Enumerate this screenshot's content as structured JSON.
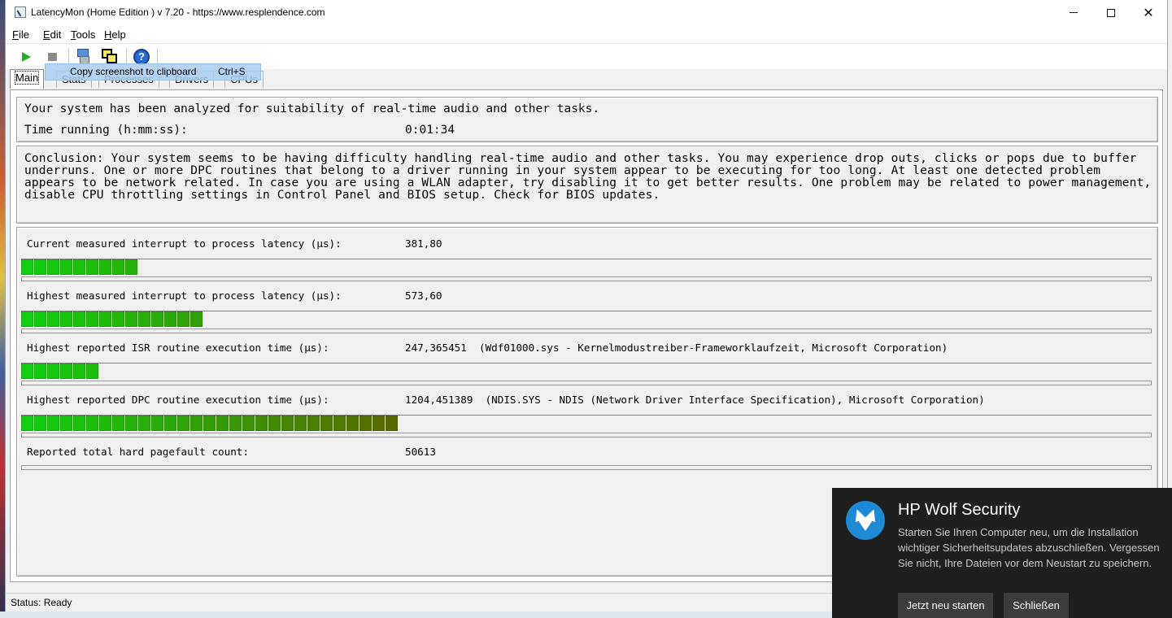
{
  "window": {
    "title": "LatencyMon  (Home Edition )  v 7.20 - https://www.resplendence.com",
    "close_glyph": "✕"
  },
  "menu": {
    "items": [
      {
        "mnemonic": "F",
        "rest": "ile"
      },
      {
        "mnemonic": "E",
        "rest": "dit"
      },
      {
        "mnemonic": "T",
        "rest": "ools"
      },
      {
        "mnemonic": "H",
        "rest": "elp"
      }
    ]
  },
  "toolbar": {
    "icons": [
      "play-icon",
      "stop-icon",
      "wrench-icon",
      "copy-screenshot-icon",
      "help-icon"
    ],
    "help_glyph": "?"
  },
  "tooltip": {
    "text": "Copy screenshot to clipboard",
    "shortcut": "Ctrl+S"
  },
  "tabs": [
    {
      "label": "Main",
      "active": true
    },
    {
      "label": "Stats"
    },
    {
      "label": "Processes"
    },
    {
      "label": "Drivers"
    },
    {
      "label": "CPUs"
    }
  ],
  "summary": {
    "line": "Your system has been analyzed for suitability of real-time audio and other tasks.",
    "time_label": "Time running (h:mm:ss):",
    "time_value": "0:01:34"
  },
  "conclusion": "Conclusion: Your system seems to be having difficulty handling real-time audio and other tasks. You may experience drop outs, clicks or pops due to buffer underruns. One or more DPC routines that belong to a driver running in your system appear to be executing for too long. At least one detected problem appears to be network related. In case you are using a WLAN adapter, try disabling it to get better results. One problem may be related to power management, disable CPU throttling settings in Control Panel and BIOS setup. Check for BIOS updates.",
  "metrics": [
    {
      "label": "Current measured interrupt to process latency (µs):",
      "value": "381,80",
      "segments": 9
    },
    {
      "label": "Highest measured interrupt to process latency (µs):",
      "value": "573,60",
      "segments": 14
    },
    {
      "label": "Highest reported ISR routine execution time (µs):",
      "value": "247,365451  (Wdf01000.sys - Kernelmodustreiber-Frameworklaufzeit, Microsoft Corporation)",
      "segments": 6
    },
    {
      "label": "Highest reported DPC routine execution time (µs):",
      "value": "1204,451389  (NDIS.SYS - NDIS (Network Driver Interface Specification), Microsoft Corporation)",
      "segments": 29
    },
    {
      "label": "Reported total hard pagefault count:",
      "value": "50613",
      "segments": 0
    }
  ],
  "status": "Status: Ready",
  "toast": {
    "title": "HP Wolf Security",
    "body": "Starten Sie Ihren Computer neu, um die Installation wichtiger Sicherheitsupdates abzuschließen. Vergessen Sie nicht, Ihre Dateien vor dem Neustart zu speichern.",
    "restart_label": "Jetzt neu starten",
    "close_label": "Schließen"
  },
  "colors": {
    "bar_green": "#10d010",
    "bar_olive": "#5a6a00",
    "toast_bg": "#1f1f1f",
    "toast_accent": "#1e8ad6"
  }
}
